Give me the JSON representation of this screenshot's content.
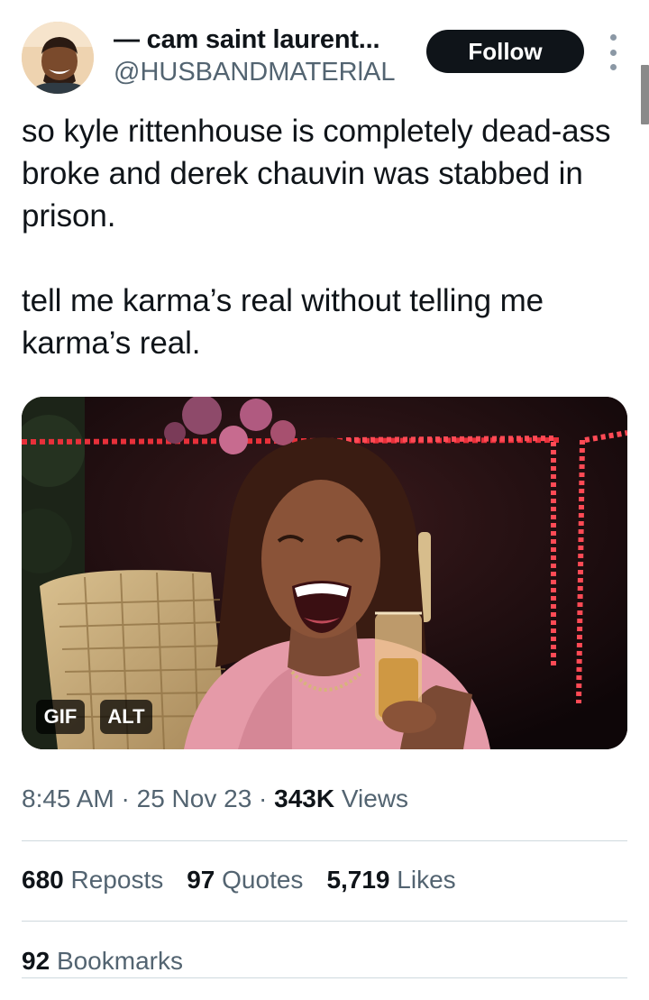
{
  "author": {
    "display_name": "— cam saint laurent...",
    "handle": "@HUSBANDMATERlAL",
    "avatar_icon": "profile-avatar"
  },
  "header": {
    "follow_label": "Follow",
    "more_icon": "more-vertical-icon"
  },
  "tweet": {
    "text": "so kyle rittenhouse is completely dead-ass broke and derek chauvin was stabbed in prison.\n\ntell me karma’s real without telling me karma’s real."
  },
  "media": {
    "type": "gif",
    "gif_badge": "GIF",
    "alt_badge": "ALT"
  },
  "meta": {
    "time": "8:45 AM",
    "date": "25 Nov 23",
    "separator": " · ",
    "views_count": "343K",
    "views_label": "Views"
  },
  "stats": {
    "reposts_count": "680",
    "reposts_label": "Reposts",
    "quotes_count": "97",
    "quotes_label": "Quotes",
    "likes_count": "5,719",
    "likes_label": "Likes",
    "bookmarks_count": "92",
    "bookmarks_label": "Bookmarks"
  },
  "colors": {
    "text_primary": "#0f1419",
    "text_secondary": "#536471",
    "follow_bg": "#0f1419",
    "divider": "#cfd9de"
  }
}
